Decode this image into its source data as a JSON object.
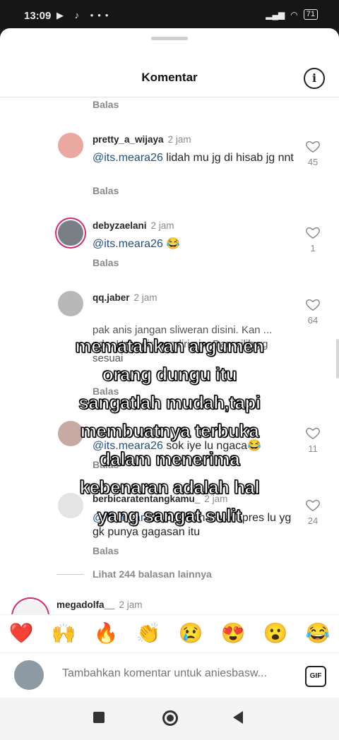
{
  "status_bar": {
    "time": "13:09",
    "battery": "71"
  },
  "header": {
    "title": "Komentar"
  },
  "top_reply_label": "Balas",
  "comments": [
    {
      "user": "pretty_a_wijaya",
      "time": "2 jam",
      "mention": "@its.meara26",
      "text": " lidah mu jg di hisab jg nnt",
      "reply": "Balas",
      "likes": "45"
    },
    {
      "user": "debyzaelani",
      "time": "2 jam",
      "mention": "@its.meara26",
      "text": " 😂",
      "reply": "Balas",
      "likes": "1"
    },
    {
      "user": "qq.jaber",
      "time": "2 jam",
      "mention": "",
      "text": "pak anis jangan sliweran disini. Kan ... nda. Urus diri sendiri aja. Dan pilih yg sesuai",
      "reply": "Balas",
      "likes": "64"
    },
    {
      "user": "",
      "time": "",
      "mention": "@its.meara26",
      "text": " sok iye lu ngaca😂",
      "reply": "Balas",
      "likes": "11"
    },
    {
      "user": "berbicaratentangkamu_",
      "time": "2 jam",
      "mention": "@its.meara26",
      "text": " cebokin trus capres lu yg gk punya gagasan itu",
      "reply": "Balas",
      "likes": "24"
    },
    {
      "user": "megadolfa__",
      "time": "2 jam"
    }
  ],
  "more_replies": "Lihat 244 balasan lainnya",
  "overlay_text": [
    "mematahkan argumen",
    "orang dungu itu",
    "sangatlah mudah,tapi",
    "membuatnya terbuka",
    "dalam menerima",
    "kebenaran adalah hal",
    "yang sangat sulit"
  ],
  "emojis": [
    "❤️",
    "🙌",
    "🔥",
    "👏",
    "😢",
    "😍",
    "😮",
    "😂"
  ],
  "comment_input": {
    "placeholder": "Tambahkan komentar untuk aniesbasw..."
  },
  "gif_label": "GIF"
}
